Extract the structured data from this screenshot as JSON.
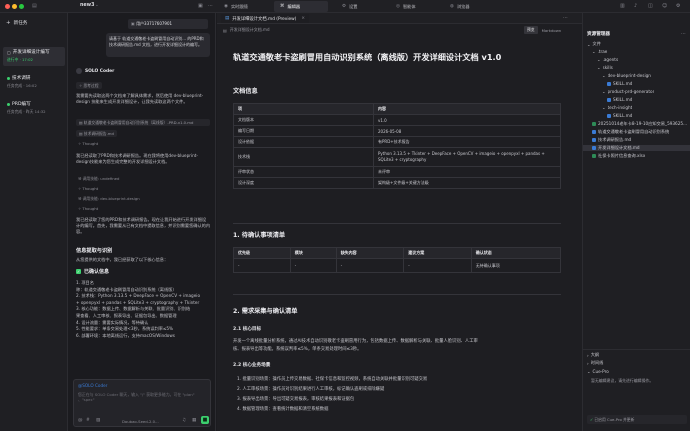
{
  "window": {
    "workspace_name": "new3",
    "user_badge": "用户33717607901"
  },
  "top_tabs": [
    {
      "label": "实时跟随"
    },
    {
      "label": "编辑器"
    },
    {
      "label": "设置"
    },
    {
      "label": "智能体"
    },
    {
      "label": "浏览器"
    }
  ],
  "tasks": {
    "new_label": "新任务",
    "items": [
      {
        "title": "开发详细设计编写",
        "status": "进行中 · 17:02"
      },
      {
        "title": "技术调研",
        "status": "任务完成 · 16:02"
      },
      {
        "title": "PRD编写",
        "status": "任务完成 · 昨天 14:32"
      }
    ]
  },
  "chat": {
    "user_message": "请基于 轨道交通敬老卡盗刷冒用自动识别... 的PRD和 技术调研报告.md 文档，进行开发详细设计的编写。",
    "agent_name": "SOLO Coder",
    "thought_label": "思考过程",
    "intro": "我需要先读取这两个文档来了解具体需求，然后使用 dev-blueprint-design 技能来生成开发详细设计，让我先读取这两个文件。",
    "file_ref_1": "轨道交通敬老卡盗刷冒用自动识别系统（离线版）-PRD-v1.0.md",
    "file_ref_2": "技术调研报告.md",
    "thought_2": "Thought",
    "para_2": "我已经读取了PRD和技术调研报告。现在我将使用dev-blueprint-design技能来为您生成完整的开发详细设计文档。",
    "sub_1": "调用技能: undefined",
    "thought_3": "Thought",
    "sub_2": "调用技能: dev-blueprint-design",
    "thought_4": "Thought",
    "para_3": "我已经读取了您的PRD和技术调研报告。现在让我开始进行开发详细设计的编写。首先，我需要从已有文档中提取信息，并识别需要您确认的内容。",
    "section_title": "信息提取与识别",
    "section_intro": "从您提供的文档中，我已经获取了以下核心信息：",
    "known_title": "已确认信息",
    "list": [
      "1. 项目名",
      "   称：轨道交通敬老卡盗刷冒用自动识别系统（离线版）",
      "2. 技术栈：Python 3.13.5 + DeepFace + OpenCV + imageio",
      "   + openpyxl + pandas + SQLite3 + cryptography + Tkinter",
      "3. 核心功能：数据上传、数据解析与关联、批量识别、识别结",
      "   果查看、人工审核、报表导出、证据包导出、数据管理",
      "4. 设计流量：需要实际情况，等待确认",
      "5. 性能要求：单条交易处理<3秒，系统误判率≤5%",
      "6. 部署环境：本地离线运行，支持macOS/Windows"
    ],
    "input_agent": "@SOLO Coder",
    "input_placeholder": "您正在与 SOLO Coder 聊天，输入 \"/\" 获取更多能力。可在 \"plan\" 、\"spec\"",
    "input_model": "Doubao-Seed-2.0..."
  },
  "editor": {
    "tab_title": "开发详细设计文档.md (Preview)",
    "breadcrumb": "开发详细设计文档.md",
    "mode_preview": "预览",
    "mode_markdown": "Markdown",
    "doc_title": "轨道交通敬老卡盗刷冒用自动识别系统（离线版）开发详细设计文档 v1.0",
    "info_heading": "文档信息",
    "info_table": {
      "headers": [
        "项",
        "内容"
      ],
      "rows": [
        [
          "文档版本",
          "v1.0"
        ],
        [
          "编写日期",
          "2026-05-08"
        ],
        [
          "设计依据",
          "有PRD+技术报告"
        ],
        [
          "技术栈",
          "Python 3.13.5 + Tkinter + DeepFace + OpenCV + imageio + openpyxl + pandas + SQLite3 + cryptography"
        ],
        [
          "评审状态",
          "未评审"
        ],
        [
          "设计深度",
          "架构级+文件级+关键方法级"
        ]
      ]
    },
    "pending_heading": "1. 待确认事项清单",
    "pending_table": {
      "headers": [
        "优先级",
        "模块",
        "缺失内容",
        "建议方案",
        "确认状态"
      ],
      "rows": [
        [
          "-",
          "-",
          "-",
          "-",
          "无待确认事项"
        ]
      ]
    },
    "req_heading": "2. 需求采集与确认清单",
    "goal_heading": "2.1 核心目标",
    "goal_text": "开发一个离线批量分析系统，通过AI技术自动识别敬老卡盗刷冒用行为，包括数据上传、数据解析与关联、批量人脸识别、人工审",
    "goal_text_2": "核、报表导出等功能。系统误判率≤5%，单条交易处理时间≤3秒。",
    "scene_heading": "2.2 核心业务场景",
    "scenes": [
      "1. 批量识别场景：操作员上传交易数据、社保卡信息和监控视频，系统自动关联并批量识别可疑交易",
      "2. 人工审核场景：操作员对识别结果进行人工审核，标记确认盗刷或排除嫌疑",
      "3. 报表导出场景：导出可疑交易报表，审核结果报表和证据包",
      "4. 数据管理场景：查看统计数据和清空系统数据"
    ]
  },
  "explorer": {
    "title": "资源管理器",
    "root": "文件",
    "items": [
      {
        "label": ".trae",
        "depth": 1,
        "kind": "folder"
      },
      {
        "label": ".agents",
        "depth": 2,
        "kind": "folder"
      },
      {
        "label": "skills",
        "depth": 2,
        "kind": "folder"
      },
      {
        "label": "dev-blueprint-design",
        "depth": 3,
        "kind": "folder"
      },
      {
        "label": "SKILL.md",
        "depth": 4,
        "kind": "md"
      },
      {
        "label": "product-prd-generator",
        "depth": 3,
        "kind": "folder"
      },
      {
        "label": "SKILL.md",
        "depth": 4,
        "kind": "md"
      },
      {
        "label": "tech-insight",
        "depth": 3,
        "kind": "folder"
      },
      {
        "label": "SKILL.md",
        "depth": 4,
        "kind": "md"
      },
      {
        "label": "20251014老年卡8-19-10应知交易_593625...",
        "depth": 1,
        "kind": "xlsx"
      },
      {
        "label": "轨道交通敬老卡盗刷冒用自动识别系统",
        "depth": 1,
        "kind": "md"
      },
      {
        "label": "技术调研报告.md",
        "depth": 1,
        "kind": "md"
      },
      {
        "label": "开发详细设计文档.md",
        "depth": 1,
        "kind": "md",
        "selected": true
      },
      {
        "label": "社保卡照片信息查询.xlsx",
        "depth": 1,
        "kind": "xlsx"
      }
    ],
    "outline": "大纲",
    "timeline": "时间线",
    "cue_title": "Cue-Pro",
    "cue_text": "暂无编辑建议，请先进行编辑操作。",
    "cue_status": "已启用 Cue-Pro 并更新"
  },
  "colors": {
    "accent_green": "#3ccf6e",
    "accent_blue": "#3a7bd5"
  }
}
